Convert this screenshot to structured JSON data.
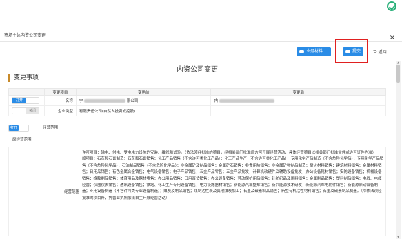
{
  "window": {
    "title": "市场主体内资公司变更",
    "close": "×"
  },
  "toolbar": {
    "materials_label": "业务材料",
    "submit_label": "提交",
    "back_label": "返回",
    "back_arrow": "⮌"
  },
  "doc": {
    "title": "内资公司变更"
  },
  "section": {
    "title": "变更事项"
  },
  "table": {
    "headers": [
      "变更项目",
      "变更前",
      "变更后"
    ],
    "rows": [
      {
        "toggle": "打开",
        "toggle_state": "on",
        "item": "名称",
        "before": "宁",
        "before_suffix": "限公司",
        "after": "内"
      },
      {
        "toggle": "关闭",
        "toggle_state": "off",
        "item": "企业类型",
        "before": "有限责任公司(自然人投资或控股)",
        "before_suffix": "",
        "after": ""
      }
    ]
  },
  "scope": {
    "toggle": "打开",
    "label": "经营范围",
    "section_head": "原经营范围",
    "row_label": "经营范围",
    "text": "许可项目：输电、供电、受电电力设施的安装、维修和试验。（依法须经批准的项目，经相关部门批准后方可开展经营活动，具体经营项目以相关部门批准文件或许可证件为准） 一般项目：石灰和石膏制造；石灰和石膏销售；化工产品销售（不含许可类化工产品）；化工产品生产（不含许可类化工产品）；专用化学产品制造（不含危险化学品）；专用化学产品销售（不含危险化学品）；石油制品销售（不含危险化学品）；非金属矿及制品销售；金属矿石销售；非食用盐销售；非金属矿物制品制造；耐火材料销售；建筑材料销售；金属材料销售；日用品销售；有色金属合金销售；电气设备销售；电子产品销售；五金产品零售；五金产品批发；计算机软硬件及辅助设备批发；办公设备耗材销售；安防设备销售；机械设备销售；橡胶制品销售；体育用品及器材零售；办公用品销售；日用百货销售；办公设备销售；劳动保护用品销售；针纺织品及原料销售；金属制品销售；塑料制品销售；电线、电缆经营；仪器仪表销售；通讯设备销售；铁路、化工生产专用设备销售；电力设施器材销售；新能源汽车整车销售；新兴能源技术研发；新能源汽车电附件销售；新能源原动设备制造；专用设备制造（不含许可类专业设备制造）；煤炭及制品销售；煤制活性炭及其他煤炭加工；石墨及碳素制品销售；新型有机活性材料销售；石墨及碳素制品制造。（除依法须经批准的项目外，凭营业执照依法自主开展经营活动）"
  }
}
